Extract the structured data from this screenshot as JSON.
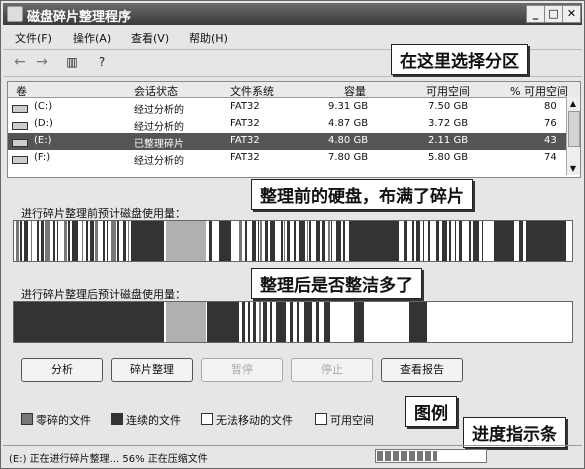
{
  "window": {
    "title": "磁盘碎片整理程序",
    "minimize": "_",
    "maximize": "□",
    "close": "✕"
  },
  "menu": [
    "文件(F)",
    "操作(A)",
    "查看(V)",
    "帮助(H)"
  ],
  "toolbar_icons": [
    "back-arrow-icon",
    "forward-arrow-icon",
    "console-tree-icon",
    "help-icon"
  ],
  "callouts": {
    "select": "在这里选择分区",
    "before": "整理前的硬盘，布满了碎片",
    "after": "整理后是否整洁多了",
    "legend": "图例",
    "progress": "进度指示条"
  },
  "columns": [
    "卷",
    "会话状态",
    "文件系统",
    "容量",
    "可用空间",
    "% 可用空间"
  ],
  "volumes": [
    {
      "vol": "(C:)",
      "status": "经过分析的",
      "fs": "FAT32",
      "cap": "9.31 GB",
      "free": "7.50 GB",
      "pct": "80"
    },
    {
      "vol": "(D:)",
      "status": "经过分析的",
      "fs": "FAT32",
      "cap": "4.87 GB",
      "free": "3.72 GB",
      "pct": "76"
    },
    {
      "vol": "(E:)",
      "status": "已整理碎片",
      "fs": "FAT32",
      "cap": "4.80 GB",
      "free": "2.11 GB",
      "pct": "43"
    },
    {
      "vol": "(F:)",
      "status": "经过分析的",
      "fs": "FAT32",
      "cap": "7.80 GB",
      "free": "5.80 GB",
      "pct": "74"
    }
  ],
  "selected_volume_index": 2,
  "before_label": "进行碎片整理前预计磁盘使用量：",
  "after_label": "进行碎片整理后预计磁盘使用量：",
  "buttons": {
    "analyze": "分析",
    "defrag": "碎片整理",
    "pause": "暂停",
    "stop": "停止",
    "report": "查看报告"
  },
  "legend": [
    {
      "label": "零碎的文件",
      "color": "#777777"
    },
    {
      "label": "连续的文件",
      "color": "#333333"
    },
    {
      "label": "无法移动的文件",
      "color": "#ffffff"
    },
    {
      "label": "可用空间",
      "color": "#ffffff"
    }
  ],
  "status": {
    "text": "(E:) 正在进行碎片整理...  56% 正在压缩文件",
    "progress": 0.56
  },
  "colors": {
    "contiguous": "#333333",
    "fragmented": "#777777",
    "unmovable": "#b0b0b0",
    "free": "#ffffff",
    "selection": "#555555"
  }
}
